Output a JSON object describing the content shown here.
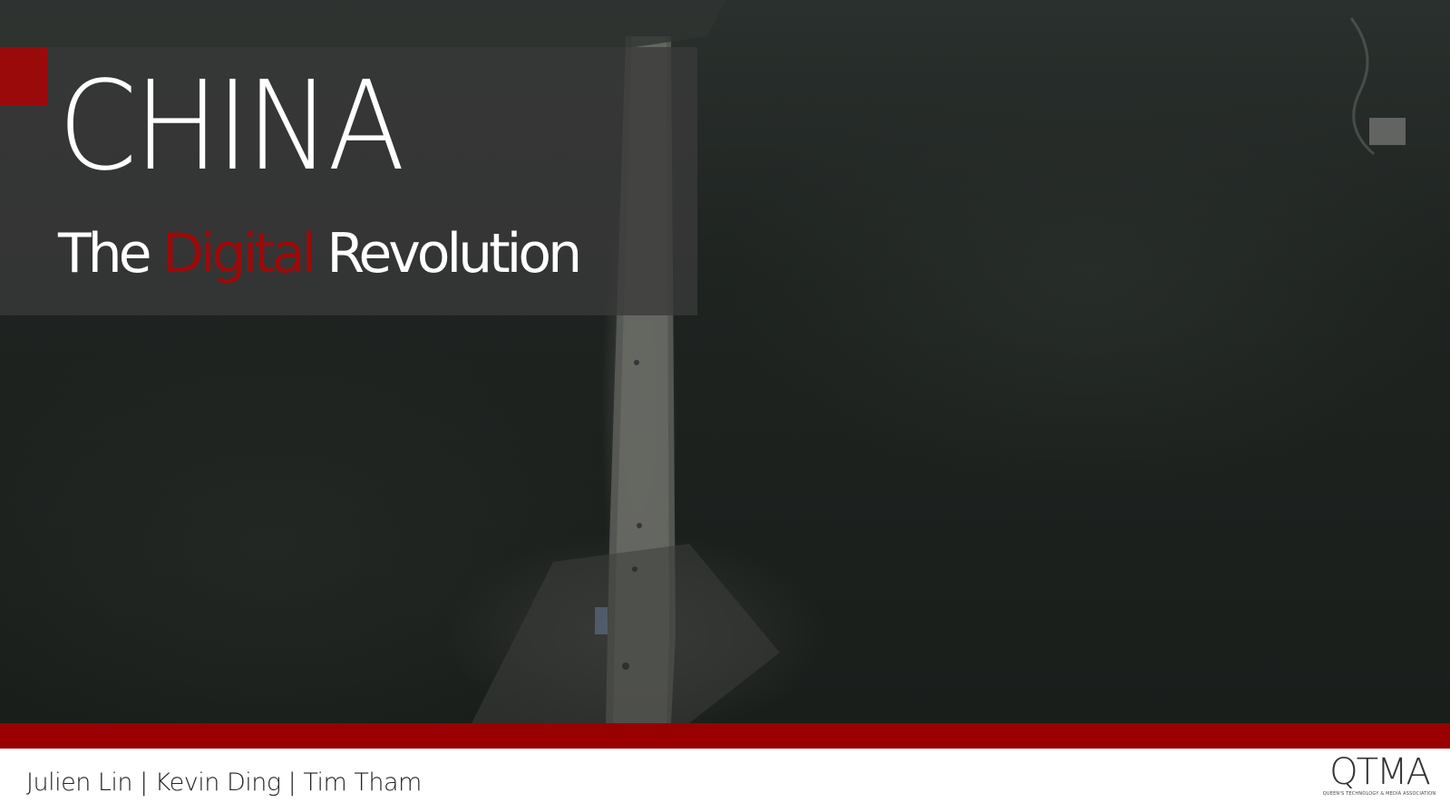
{
  "slide": {
    "title": "CHINA",
    "subtitle": {
      "before": "The ",
      "accent": "Digital",
      "after": " Revolution"
    },
    "authors": "Julien Lin | Kevin Ding | Tim Tham",
    "logo": {
      "mark": "QTMA",
      "tagline": "Queen's Technology & Media Association"
    },
    "background": "great-wall-aerial-photo"
  },
  "colors": {
    "accent": "#9b0a0a",
    "bar": "#990000",
    "panel": "#3a3a3a",
    "footer": "#ffffff"
  }
}
